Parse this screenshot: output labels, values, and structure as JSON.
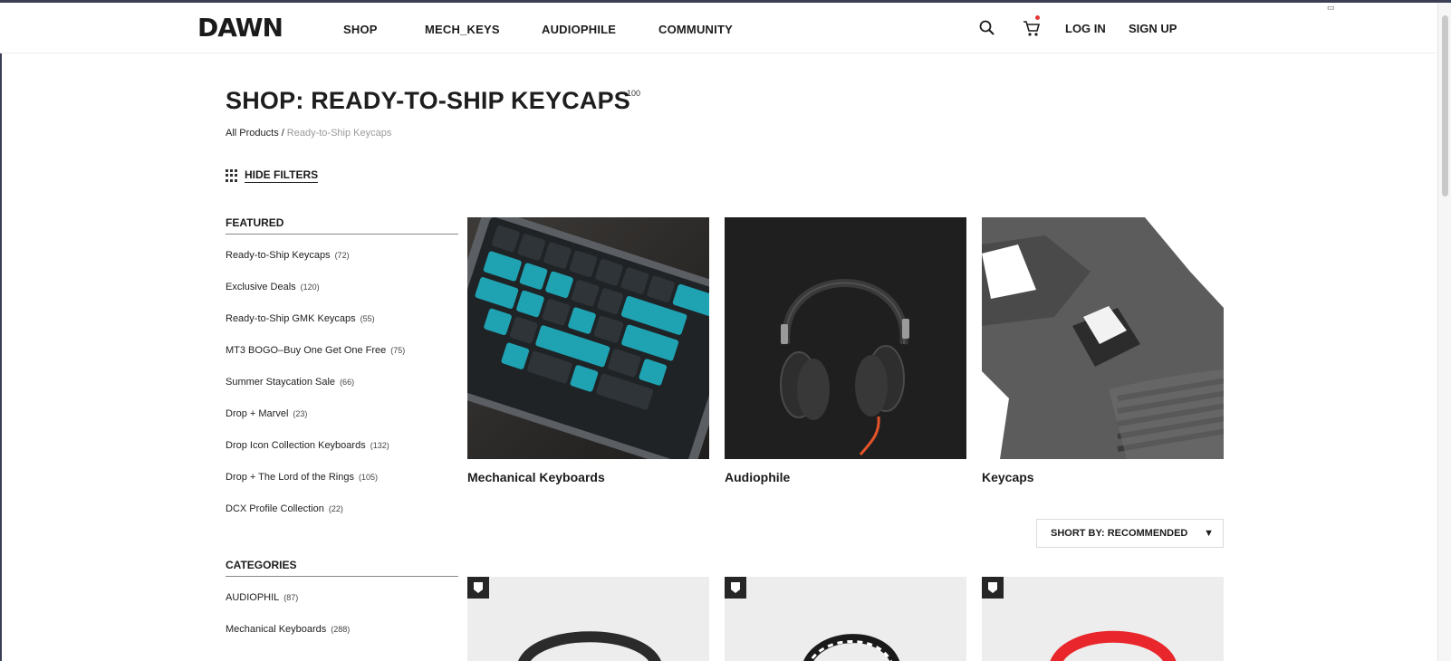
{
  "brand": {
    "logo_text": "DAWN"
  },
  "nav": {
    "items": [
      "SHOP",
      "MECH_KEYS",
      "AUDIOPHILE",
      "COMMUNITY"
    ]
  },
  "header": {
    "search_icon": "search-icon",
    "cart_icon": "cart-icon",
    "login": "LOG IN",
    "signup": "SIGN UP"
  },
  "page": {
    "title": "SHOP: READY-TO-SHIP KEYCAPS",
    "title_count": "100",
    "breadcrumb": {
      "root": "All Products",
      "separator": "/",
      "current": "Ready-to-Ship Keycaps"
    },
    "hide_filters": "HIDE FILTERS"
  },
  "filters": {
    "featured": {
      "heading": "FEATURED",
      "items": [
        {
          "label": "Ready-to-Ship Keycaps",
          "count": "(72)"
        },
        {
          "label": "Exclusive Deals",
          "count": "(120)"
        },
        {
          "label": "Ready-to-Ship GMK Keycaps",
          "count": "(55)"
        },
        {
          "label": "MT3 BOGO–Buy One Get One Free",
          "count": "(75)"
        },
        {
          "label": "Summer Staycation Sale",
          "count": "(66)"
        },
        {
          "label": "Drop + Marvel",
          "count": "(23)"
        },
        {
          "label": "Drop Icon Collection Keyboards",
          "count": "(132)"
        },
        {
          "label": "Drop + The Lord of the Rings",
          "count": "(105)"
        },
        {
          "label": "DCX Profile Collection",
          "count": "(22)"
        }
      ]
    },
    "categories": {
      "heading": "CATEGORIES",
      "items": [
        {
          "label": "AUDIOPHIL",
          "count": "(87)"
        },
        {
          "label": "Mechanical Keyboards",
          "count": "(288)"
        }
      ]
    }
  },
  "category_cards": [
    {
      "name": "Mechanical Keyboards"
    },
    {
      "name": "Audiophile"
    },
    {
      "name": "Keycaps"
    }
  ],
  "sort": {
    "label": "SHORT BY: RECOMMENDED",
    "arrow": "▼"
  },
  "colors": {
    "accent": "#e23636",
    "text": "#1c1c1c",
    "muted": "#9a9a9a",
    "card_bg": "#ededed"
  }
}
